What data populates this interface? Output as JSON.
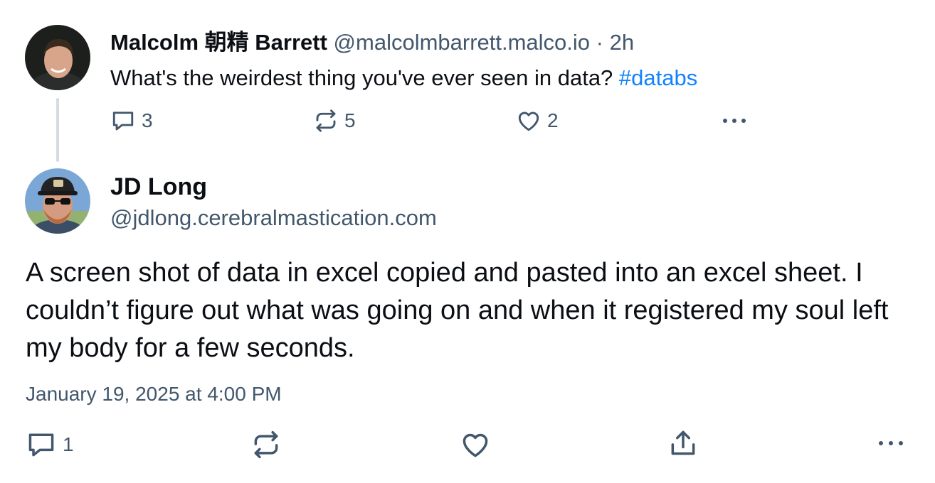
{
  "parent_post": {
    "author_name": "Malcolm 朝精 Barrett",
    "author_handle": "@malcolmbarrett.malco.io",
    "separator": "·",
    "time_ago": "2h",
    "text": "What's the weirdest thing you've ever seen in data?",
    "hashtag": "#databs",
    "actions": {
      "reply_count": "3",
      "repost_count": "5",
      "like_count": "2",
      "icons": [
        "reply-icon",
        "repost-icon",
        "like-icon",
        "more-icon"
      ]
    }
  },
  "reply_post": {
    "author_name": "JD Long",
    "author_handle": "@jdlong.cerebralmastication.com",
    "text": "A screen shot of data in excel copied and pasted into an excel sheet. I couldn’t figure out what was going on and when it registered my soul left my body for a few seconds.",
    "date": "January 19, 2025 at 4:00 PM",
    "actions": {
      "reply_count": "1",
      "icons": [
        "reply-icon",
        "repost-icon",
        "like-icon",
        "share-icon",
        "more-icon"
      ]
    }
  },
  "colors": {
    "text_primary": "#0b0f14",
    "text_secondary": "#42576c",
    "link": "#1083fe",
    "thread_line": "#d4dbe2"
  }
}
